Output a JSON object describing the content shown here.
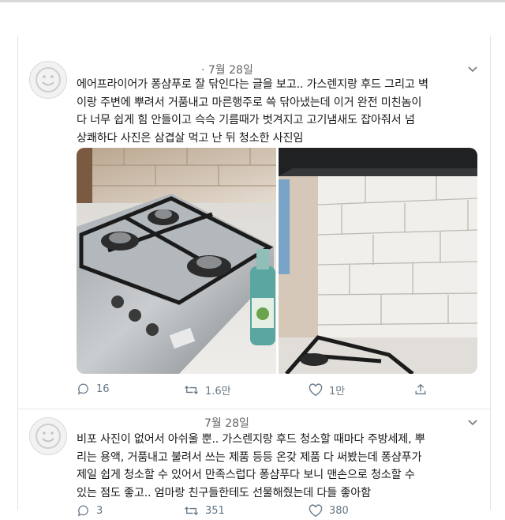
{
  "tweets": [
    {
      "date": "· 7월 28일",
      "lines": [
        "에어프라이어가 퐁샴푸로 잘 닦인다는 글을 보고.. 가스렌지랑 후드 그리고 벽",
        "이랑 주변에 뿌려서 거품내고 마른행주로 쓱 닦아냈는데 이거 완전 미친놈이",
        "다 너무 쉽게 힘 안들이고 슥슥 기름때가 벗겨지고 고기냄새도 잡아줘서 넘",
        "상쾌하다 사진은 삼겹살 먹고 난 뒤 청소한 사진임"
      ],
      "reply_count": "16",
      "retweet_count": "1.6만",
      "like_count": "1만"
    },
    {
      "date": "7월 28일",
      "lines": [
        "비포 사진이 없어서 아쉬울 뿐.. 가스렌지랑 후드 청소할 때마다 주방세제, 뿌",
        "리는 용액, 거품내고 불려서 쓰는 제품 등등 온갖 제품 다 써봤는데 퐁샴푸가",
        "제일 쉽게 청소할 수 있어서 만족스럽다 퐁샴푸다 보니 맨손으로 청소할 수",
        "있는 점도 좋고.. 엄마랑 친구들한테도 선물해줬는데 다들 좋아함"
      ],
      "reply_count": "3",
      "retweet_count": "351",
      "like_count": "380"
    }
  ]
}
